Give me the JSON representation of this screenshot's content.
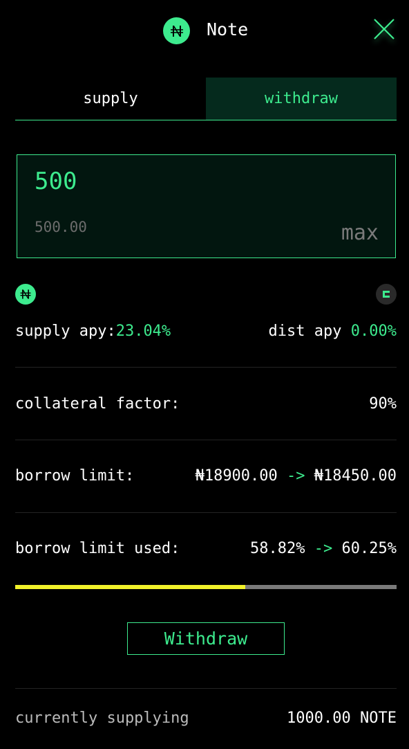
{
  "header": {
    "title": "Note",
    "logo_glyph": "₦",
    "close_icon": "close-icon"
  },
  "tabs": [
    {
      "label": "supply"
    },
    {
      "label": "withdraw",
      "active": true
    }
  ],
  "input": {
    "amount": "500",
    "usd_value": "500.00",
    "max_label": "max"
  },
  "apy": {
    "supply_label": "supply apy:",
    "supply_value": "23.04%",
    "dist_label": "dist apy ",
    "dist_value": "0.00%"
  },
  "collateral": {
    "label": "collateral factor:",
    "value": "90%"
  },
  "borrow_limit": {
    "label": "borrow limit:",
    "from": "₦18900.00",
    "arrow": " -> ",
    "to": "₦18450.00"
  },
  "borrow_used": {
    "label": "borrow limit used:",
    "from": "58.82%",
    "arrow": " -> ",
    "to": "60.25%",
    "progress_fraction": 0.6025
  },
  "action": {
    "button_label": "Withdraw"
  },
  "supplying": {
    "label": "currently supplying",
    "value": "1000.00 NOTE"
  },
  "colors": {
    "accent": "#3deb8e",
    "bar_fill": "#f2f22a",
    "bar_track": "#7a7a7a"
  }
}
